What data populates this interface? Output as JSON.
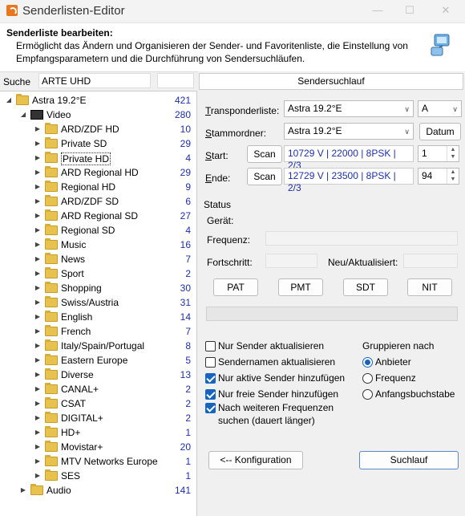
{
  "window": {
    "title": "Senderlisten-Editor"
  },
  "header": {
    "title": "Senderliste bearbeiten:",
    "description": "Ermöglicht das Ändern und Organisieren der Sender- und Favoritenliste, die Einstellung von Empfangsparametern und die Durchführung von Sendersuchläufen."
  },
  "search": {
    "label": "Suche",
    "value": "ARTE UHD"
  },
  "tree": {
    "root": {
      "label": "Astra 19.2°E",
      "count": "421"
    },
    "video": {
      "label": "Video",
      "count": "280"
    },
    "folders": [
      {
        "label": "ARD/ZDF HD",
        "count": "10"
      },
      {
        "label": "Private SD",
        "count": "29"
      },
      {
        "label": "Private HD",
        "count": "4"
      },
      {
        "label": "ARD Regional HD",
        "count": "29"
      },
      {
        "label": "Regional HD",
        "count": "9"
      },
      {
        "label": "ARD/ZDF SD",
        "count": "6"
      },
      {
        "label": "ARD Regional SD",
        "count": "27"
      },
      {
        "label": "Regional SD",
        "count": "4"
      },
      {
        "label": "Music",
        "count": "16"
      },
      {
        "label": "News",
        "count": "7"
      },
      {
        "label": "Sport",
        "count": "2"
      },
      {
        "label": "Shopping",
        "count": "30"
      },
      {
        "label": "Swiss/Austria",
        "count": "31"
      },
      {
        "label": "English",
        "count": "14"
      },
      {
        "label": "French",
        "count": "7"
      },
      {
        "label": "Italy/Spain/Portugal",
        "count": "8"
      },
      {
        "label": "Eastern Europe",
        "count": "5"
      },
      {
        "label": "Diverse",
        "count": "13"
      },
      {
        "label": "CANAL+",
        "count": "2"
      },
      {
        "label": "CSAT",
        "count": "2"
      },
      {
        "label": "DIGITAL+",
        "count": "2"
      },
      {
        "label": "HD+",
        "count": "1"
      },
      {
        "label": "Movistar+",
        "count": "20"
      },
      {
        "label": "MTV Networks Europe",
        "count": "1"
      },
      {
        "label": "SES",
        "count": "1"
      }
    ],
    "audio": {
      "label": "Audio",
      "count": "141"
    }
  },
  "scan": {
    "title": "Sendersuchlauf",
    "transponder_label": "Transponderliste:",
    "transponder_value": "Astra 19.2°E",
    "polarity_value": "A",
    "master_label": "Stammordner:",
    "master_value": "Astra 19.2°E",
    "date_button": "Datum",
    "start_label": "Start:",
    "start_tp": "10729 V | 22000 | 8PSK | 2/3",
    "start_num": "1",
    "end_label": "Ende:",
    "end_tp": "12729 V | 23500 | 8PSK | 2/3",
    "end_num": "94",
    "scan_button": "Scan"
  },
  "status": {
    "group_label": "Status",
    "device_label": "Gerät:",
    "frequency_label": "Frequenz:",
    "progress_label": "Fortschritt:",
    "new_label": "Neu/Aktualisiert:",
    "progress_value": 0,
    "buttons": [
      "PAT",
      "PMT",
      "SDT",
      "NIT"
    ]
  },
  "options": [
    {
      "label": "Nur Sender aktualisieren",
      "checked": false
    },
    {
      "label": "Sendernamen aktualisieren",
      "checked": false
    },
    {
      "label": "Nur aktive Sender hinzufügen",
      "checked": true
    },
    {
      "label": "Nur freie Sender hinzufügen",
      "checked": true
    },
    {
      "label": "Nach weiteren Frequenzen",
      "label2": "suchen (dauert länger)",
      "checked": true
    }
  ],
  "grouping": {
    "title": "Gruppieren nach",
    "options": [
      {
        "label": "Anbieter",
        "checked": true
      },
      {
        "label": "Frequenz",
        "checked": false
      },
      {
        "label": "Anfangsbuchstabe",
        "checked": false
      }
    ]
  },
  "footer": {
    "config_button": "<-- Konfiguration",
    "search_button": "Suchlauf"
  },
  "colors": {
    "count": "#1c2fb3",
    "accent": "#1565c0",
    "folder": "#e8c24f"
  }
}
